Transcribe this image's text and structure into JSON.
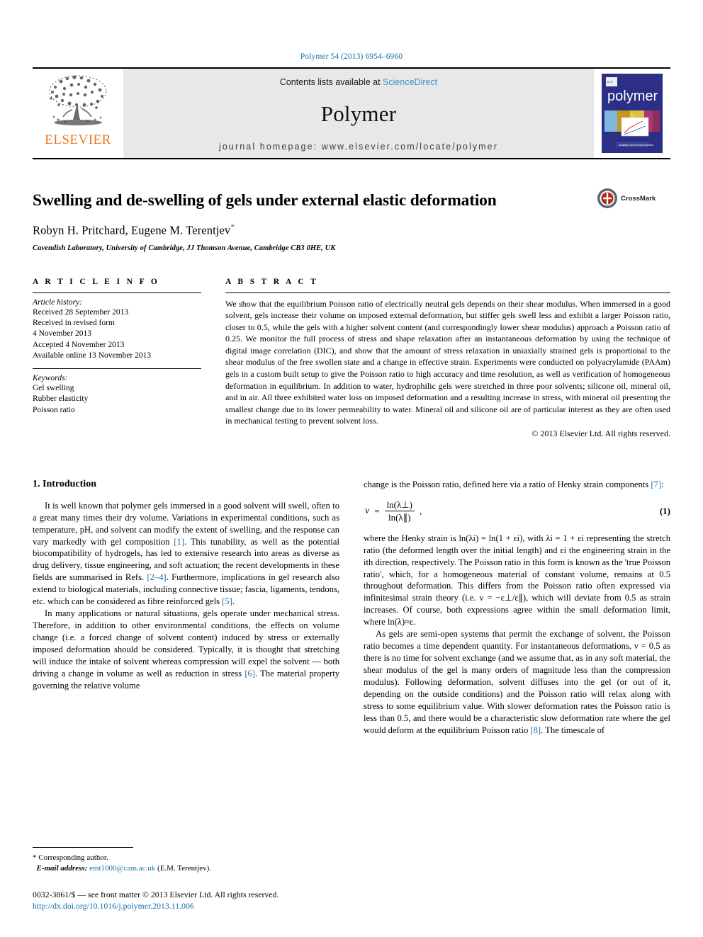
{
  "running_head": "Polymer 54 (2013) 6954–6960",
  "masthead": {
    "publisher_name": "ELSEVIER",
    "contents_prefix": "Contents lists available at ",
    "contents_link": "ScienceDirect",
    "journal_name": "Polymer",
    "homepage": "journal homepage: www.elsevier.com/locate/polymer",
    "cover_title": "polymer"
  },
  "article": {
    "title": "Swelling and de-swelling of gels under external elastic deformation",
    "authors": "Robyn H. Pritchard, Eugene M. Terentjev",
    "corresponding_marker": "*",
    "affiliation": "Cavendish Laboratory, University of Cambridge, JJ Thomson Avenue, Cambridge CB3 0HE, UK",
    "crossmark_label": "CrossMark"
  },
  "article_info": {
    "heading": "A R T I C L E   I N F O",
    "history_label": "Article history:",
    "history": [
      "Received 28 September 2013",
      "Received in revised form",
      "4 November 2013",
      "Accepted 4 November 2013",
      "Available online 13 November 2013"
    ],
    "keywords_label": "Keywords:",
    "keywords": [
      "Gel swelling",
      "Rubber elasticity",
      "Poisson ratio"
    ]
  },
  "abstract": {
    "heading": "A B S T R A C T",
    "text": "We show that the equilibrium Poisson ratio of electrically neutral gels depends on their shear modulus. When immersed in a good solvent, gels increase their volume on imposed external deformation, but stiffer gels swell less and exhibit a larger Poisson ratio, closer to 0.5, while the gels with a higher solvent content (and correspondingly lower shear modulus) approach a Poisson ratio of 0.25. We monitor the full process of stress and shape relaxation after an instantaneous deformation by using the technique of digital image correlation (DIC), and show that the amount of stress relaxation in uniaxially strained gels is proportional to the shear modulus of the free swollen state and a change in effective strain. Experiments were conducted on polyacrylamide (PAAm) gels in a custom built setup to give the Poisson ratio to high accuracy and time resolution, as well as verification of homogeneous deformation in equilibrium. In addition to water, hydrophilic gels were stretched in three poor solvents; silicone oil, mineral oil, and in air. All three exhibited water loss on imposed deformation and a resulting increase in stress, with mineral oil presenting the smallest change due to its lower permeability to water. Mineral oil and silicone oil are of particular interest as they are often used in mechanical testing to prevent solvent loss.",
    "copyright": "© 2013 Elsevier Ltd. All rights reserved."
  },
  "body": {
    "section_number_title": "1.  Introduction",
    "left_par1_a": "It is well known that polymer gels immersed in a good solvent will swell, often to a great many times their dry volume. Variations in experimental conditions, such as temperature, pH, and solvent can modify the extent of swelling, and the response can vary markedly with gel composition ",
    "left_par1_cite1": "[1]",
    "left_par1_b": ". This tunability, as well as the potential biocompatibility of hydrogels, has led to extensive research into areas as diverse as drug delivery, tissue engineering, and soft actuation; the recent developments in these fields are summarised in Refs. ",
    "left_par1_cite2": "[2–4]",
    "left_par1_c": ". Furthermore, implications in gel research also extend to biological materials, including connective tissue; fascia, ligaments, tendons, etc. which can be considered as fibre reinforced gels ",
    "left_par1_cite3": "[5]",
    "left_par1_d": ".",
    "left_par2_a": "In many applications or natural situations, gels operate under mechanical stress. Therefore, in addition to other environmental conditions, the effects on volume change (i.e. a forced change of solvent content) induced by stress or externally imposed deformation should be considered. Typically, it is thought that stretching will induce the intake of solvent whereas compression will expel the solvent — both driving a change in volume as well as reduction in stress ",
    "left_par2_cite": "[6]",
    "left_par2_b": ". The material property governing the relative volume",
    "right_par1_a": "change is the Poisson ratio, defined here via a ratio of Henky strain components ",
    "right_par1_cite": "[7]",
    "right_par1_b": ":",
    "equation": {
      "lhs": "ν",
      "equals": "=",
      "numerator": "ln(λ⊥)",
      "denominator": "ln(λ∥)",
      "comma": ",",
      "number": "(1)"
    },
    "right_par2": "where the Henky strain is ln(λi) = ln(1 + εi), with λi = 1 + εi representing the stretch ratio (the deformed length over the initial length) and εi the engineering strain in the ith direction, respectively. The Poisson ratio in this form is known as the 'true Poisson ratio', which, for a homogeneous material of constant volume, remains at 0.5 throughout deformation. This differs from the Poisson ratio often expressed via infinitesimal strain theory (i.e. ν = −ε⊥/ε∥), which will deviate from 0.5 as strain increases. Of course, both expressions agree within the small deformation limit, where ln(λ)≈ε.",
    "right_par3_a": "As gels are semi-open systems that permit the exchange of solvent, the Poisson ratio becomes a time dependent quantity. For instantaneous deformations, ν = 0.5 as there is no time for solvent exchange (and we assume that, as in any soft material, the shear modulus of the gel is many orders of magnitude less than the compression modulus). Following deformation, solvent diffuses into the gel (or out of it, depending on the outside conditions) and the Poisson ratio will relax along with stress to some equilibrium value. With slower deformation rates the Poisson ratio is less than 0.5, and there would be a characteristic slow deformation rate where the gel would deform at the equilibrium Poisson ratio ",
    "right_par3_cite": "[8]",
    "right_par3_b": ". The timescale of"
  },
  "footer": {
    "corresponding_author": "* Corresponding author.",
    "email_label": "E-mail address:",
    "email": "emt1000@cam.ac.uk",
    "email_suffix": "(E.M. Terentjev).",
    "issn_line": "0032-3861/$ — see front matter © 2013 Elsevier Ltd. All rights reserved.",
    "doi": "http://dx.doi.org/10.1016/j.polymer.2013.11.006"
  },
  "colors": {
    "link": "#1a6ea8",
    "elsevier_orange": "#E87722",
    "masthead_bg": "#e8e8e8",
    "cover_blue": "#2b2f86"
  }
}
